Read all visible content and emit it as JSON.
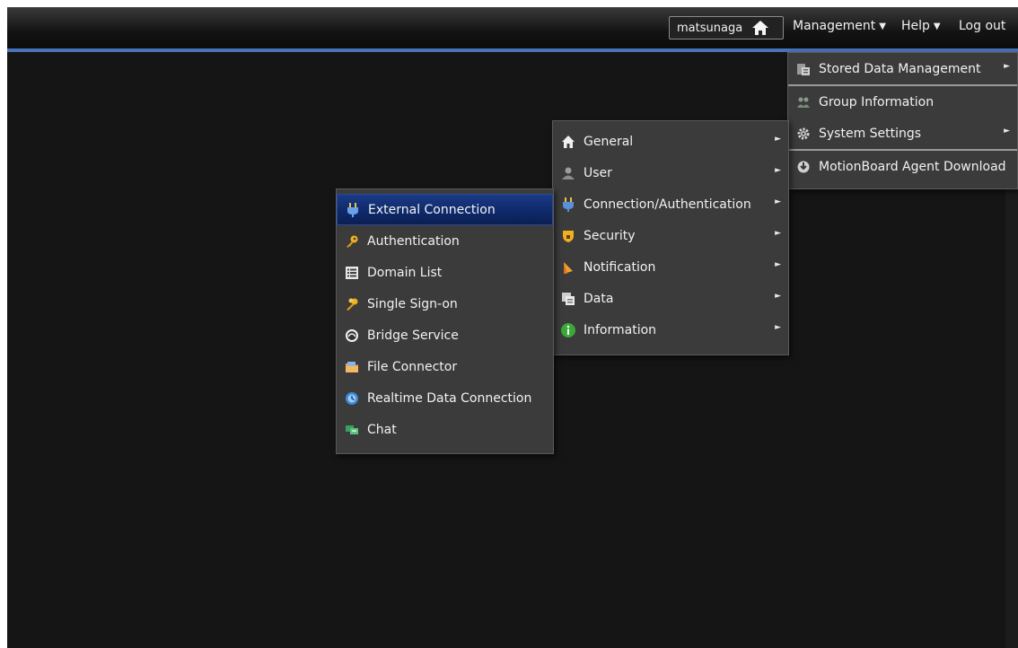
{
  "header": {
    "username": "matsunaga",
    "nav": [
      {
        "label": "Management",
        "caret": "▼"
      },
      {
        "label": "Help",
        "caret": "▼"
      },
      {
        "label": "Log out"
      }
    ]
  },
  "management_menu": {
    "items": [
      {
        "label": "Stored Data Management",
        "icon": "database-icon",
        "submenu_arrow": "►"
      },
      {
        "label": "Group Information",
        "icon": "group-icon"
      },
      {
        "label": "System Settings",
        "icon": "gear-icon",
        "submenu_arrow": "►"
      },
      {
        "label": "MotionBoard Agent Download",
        "icon": "agent-download-icon"
      }
    ]
  },
  "system_settings_menu": {
    "items": [
      {
        "label": "General",
        "icon": "house-icon",
        "submenu_arrow": "►"
      },
      {
        "label": "User",
        "icon": "user-icon",
        "submenu_arrow": "►"
      },
      {
        "label": "Connection/Authentication",
        "icon": "plug-icon",
        "submenu_arrow": "►"
      },
      {
        "label": "Security",
        "icon": "shield-icon",
        "submenu_arrow": "►"
      },
      {
        "label": "Notification",
        "icon": "bell-icon",
        "submenu_arrow": "►"
      },
      {
        "label": "Data",
        "icon": "data-icon",
        "submenu_arrow": "►"
      },
      {
        "label": "Information",
        "icon": "info-icon",
        "submenu_arrow": "►"
      }
    ]
  },
  "connection_menu": {
    "items": [
      {
        "label": "External Connection",
        "icon": "plug-icon",
        "selected": true
      },
      {
        "label": "Authentication",
        "icon": "key-icon"
      },
      {
        "label": "Domain List",
        "icon": "list-icon"
      },
      {
        "label": "Single Sign-on",
        "icon": "keys-icon"
      },
      {
        "label": "Bridge Service",
        "icon": "bridge-icon"
      },
      {
        "label": "File Connector",
        "icon": "folder-icon"
      },
      {
        "label": "Realtime Data Connection",
        "icon": "realtime-icon"
      },
      {
        "label": "Chat",
        "icon": "chat-icon"
      }
    ]
  },
  "colors": {
    "background": "#151515",
    "menu_bg": "#3b3b3b",
    "accent_line": "#4a72b8",
    "selected_item": "#0f2a6a"
  }
}
